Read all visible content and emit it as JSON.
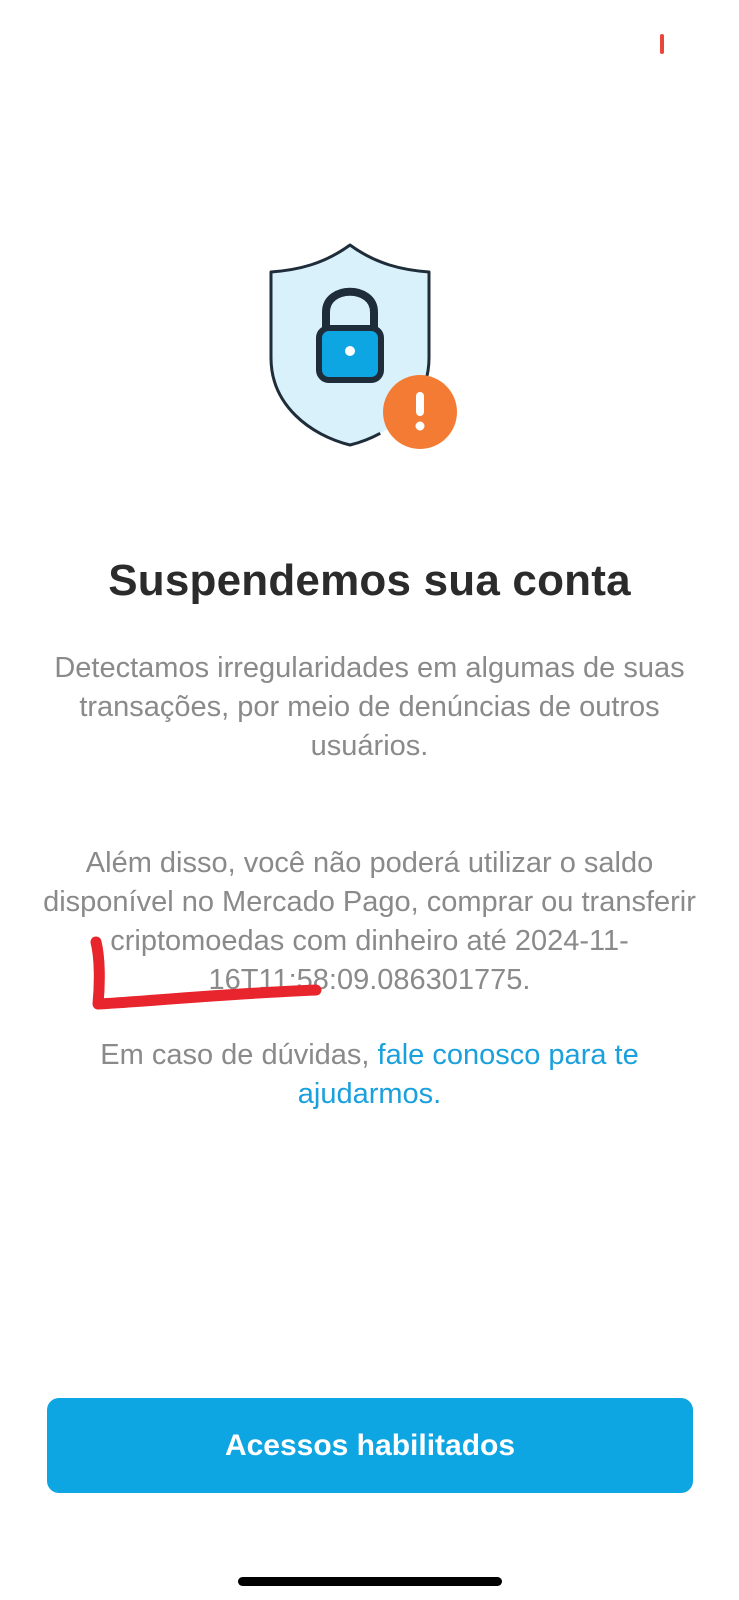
{
  "status_bar": {
    "indicator_color": "#e8453c"
  },
  "illustration": {
    "icon": "shield-lock-alert-icon",
    "shield_fill": "#d9f1fb",
    "lock_color": "#0ea5e3",
    "alert_color": "#f47b34",
    "alert_symbol": "!"
  },
  "screen": {
    "title": "Suspendemos sua conta",
    "paragraph_1": "Detectamos irregularidades em algumas de suas transações, por meio de denúncias de outros usuários.",
    "paragraph_2_prefix": "Além disso, você não poderá utilizar o saldo disponível no Mercado Pago, comprar ou transferir criptomoedas com dinheiro até ",
    "paragraph_2_date": "2024-11-16T11:58:09.086301775.",
    "help_prefix": "Em caso de dúvidas, ",
    "help_link": "fale conosco para te ajudarmos."
  },
  "annotation": {
    "color": "#e8242c",
    "shape": "hand-drawn-l-mark"
  },
  "footer": {
    "primary_button_label": "Acessos habilitados",
    "primary_button_color": "#0ea5e3"
  }
}
